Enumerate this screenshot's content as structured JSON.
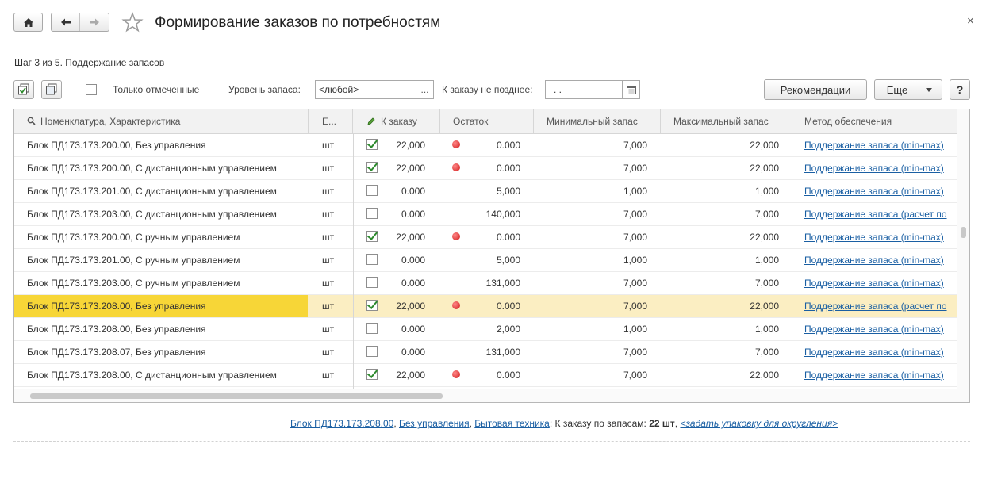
{
  "window": {
    "title": "Формирование заказов по потребностям",
    "step": "Шаг 3 из 5. Поддержание запасов"
  },
  "toolbar": {
    "only_marked_label": "Только отмеченные",
    "stock_level_label": "Уровень запаса:",
    "stock_level_value": "<любой>",
    "deadline_label": "К заказу не позднее:",
    "deadline_value": " .  .",
    "recommendations_label": "Рекомендации",
    "more_label": "Еще",
    "help_label": "?"
  },
  "grid": {
    "columns": {
      "name": "Номенклатура, Характеристика",
      "unit": "Е...",
      "to_order": "К заказу",
      "remainder": "Остаток",
      "min_stock": "Минимальный запас",
      "max_stock": "Максимальный запас",
      "method": "Метод обеспечения"
    },
    "rows": [
      {
        "name": "Блок ПД173.173.200.00, Без управления",
        "unit": "шт",
        "checked": true,
        "order": "22,000",
        "dot": true,
        "remainder": "0.000",
        "min": "7,000",
        "max": "22,000",
        "method": "Поддержание запаса (min-max)"
      },
      {
        "name": "Блок ПД173.173.200.00, С дистанционным управлением",
        "unit": "шт",
        "checked": true,
        "order": "22,000",
        "dot": true,
        "remainder": "0.000",
        "min": "7,000",
        "max": "22,000",
        "method": "Поддержание запаса (min-max)"
      },
      {
        "name": "Блок ПД173.173.201.00, С дистанционным управлением",
        "unit": "шт",
        "checked": false,
        "order": "0.000",
        "dot": false,
        "remainder": "5,000",
        "min": "1,000",
        "max": "1,000",
        "method": "Поддержание запаса (min-max)"
      },
      {
        "name": "Блок ПД173.173.203.00, С дистанционным управлением",
        "unit": "шт",
        "checked": false,
        "order": "0.000",
        "dot": false,
        "remainder": "140,000",
        "min": "7,000",
        "max": "7,000",
        "method": "Поддержание запаса (расчет по"
      },
      {
        "name": "Блок ПД173.173.200.00, С ручным управлением",
        "unit": "шт",
        "checked": true,
        "order": "22,000",
        "dot": true,
        "remainder": "0.000",
        "min": "7,000",
        "max": "22,000",
        "method": "Поддержание запаса (min-max)"
      },
      {
        "name": "Блок ПД173.173.201.00, С ручным управлением",
        "unit": "шт",
        "checked": false,
        "order": "0.000",
        "dot": false,
        "remainder": "5,000",
        "min": "1,000",
        "max": "1,000",
        "method": "Поддержание запаса (min-max)"
      },
      {
        "name": "Блок ПД173.173.203.00, С ручным управлением",
        "unit": "шт",
        "checked": false,
        "order": "0.000",
        "dot": false,
        "remainder": "131,000",
        "min": "7,000",
        "max": "7,000",
        "method": "Поддержание запаса (min-max)"
      },
      {
        "name": "Блок ПД173.173.208.00, Без управления",
        "unit": "шт",
        "checked": true,
        "order": "22,000",
        "dot": true,
        "remainder": "0.000",
        "min": "7,000",
        "max": "22,000",
        "method": "Поддержание запаса (расчет по",
        "selected": true
      },
      {
        "name": "Блок ПД173.173.208.00, Без управления",
        "unit": "шт",
        "checked": false,
        "order": "0.000",
        "dot": false,
        "remainder": "2,000",
        "min": "1,000",
        "max": "1,000",
        "method": "Поддержание запаса (min-max)"
      },
      {
        "name": "Блок ПД173.173.208.07, Без управления",
        "unit": "шт",
        "checked": false,
        "order": "0.000",
        "dot": false,
        "remainder": "131,000",
        "min": "7,000",
        "max": "7,000",
        "method": "Поддержание запаса (min-max)"
      },
      {
        "name": "Блок ПД173.173.208.00, С дистанционным управлением",
        "unit": "шт",
        "checked": true,
        "order": "22,000",
        "dot": true,
        "remainder": "0.000",
        "min": "7,000",
        "max": "22,000",
        "method": "Поддержание запаса (min-max)"
      }
    ]
  },
  "status": {
    "item_link": "Блок ПД173.173.208.00",
    "sep1": ",",
    "char_link": "Без управления",
    "sep2": ",",
    "group_link": "Бытовая техника",
    "label": ": К заказу по запасам:",
    "qty": "22 шт",
    "sep3": ",",
    "pack_link": "<задать упаковку для округления>"
  },
  "colors": {
    "selected_row": "#fbeec2",
    "selected_cell": "#f7d637",
    "link": "#1a5fa3",
    "dot_red": "#d01616",
    "check_green": "#2d8a2d"
  },
  "icons": [
    "home-icon",
    "back-arrow-icon",
    "forward-arrow-icon",
    "star-icon",
    "close-icon",
    "check-all-icon",
    "uncheck-all-icon",
    "calendar-icon",
    "dropdown-arrow-icon",
    "search-icon",
    "pencil-icon"
  ]
}
